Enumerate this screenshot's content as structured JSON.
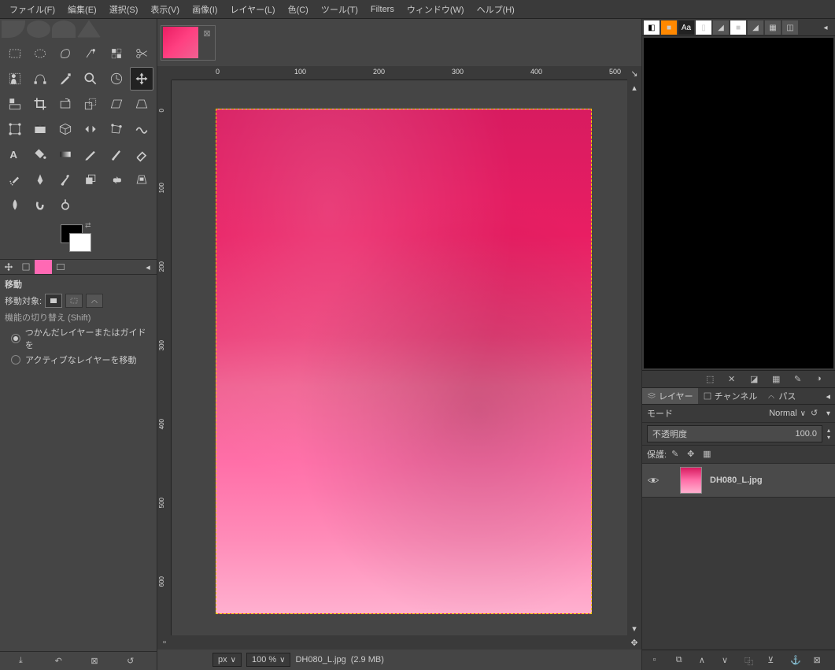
{
  "menu": [
    "ファイル(F)",
    "編集(E)",
    "選択(S)",
    "表示(V)",
    "画像(I)",
    "レイヤー(L)",
    "色(C)",
    "ツール(T)",
    "Filters",
    "ウィンドウ(W)",
    "ヘルプ(H)"
  ],
  "tool_options": {
    "title": "移動",
    "target_label": "移動対象:",
    "toggle_label": "機能の切り替え (Shift)",
    "radio1": "つかんだレイヤーまたはガイドを",
    "radio2": "アクティブなレイヤーを移動"
  },
  "document": {
    "filename": "DH080_L.jpg",
    "size_text": "(2.9 MB)"
  },
  "ruler_top": [
    "0",
    "100",
    "200",
    "300",
    "400",
    "500"
  ],
  "ruler_left": [
    "0",
    "100",
    "200",
    "300",
    "400",
    "500",
    "600"
  ],
  "status": {
    "unit": "px",
    "zoom": "100 %"
  },
  "right": {
    "layers_tab": "レイヤー",
    "channels_tab": "チャンネル",
    "paths_tab": "パス",
    "mode_label": "モード",
    "mode_value": "Normal",
    "opacity_label": "不透明度",
    "opacity_value": "100.0",
    "lock_label": "保護:",
    "layer_name": "DH080_L.jpg"
  },
  "rp_top_tabs": [
    "◧",
    "■",
    "Aa",
    "▯",
    "◢",
    "■",
    "◢",
    "▦",
    "◫"
  ]
}
